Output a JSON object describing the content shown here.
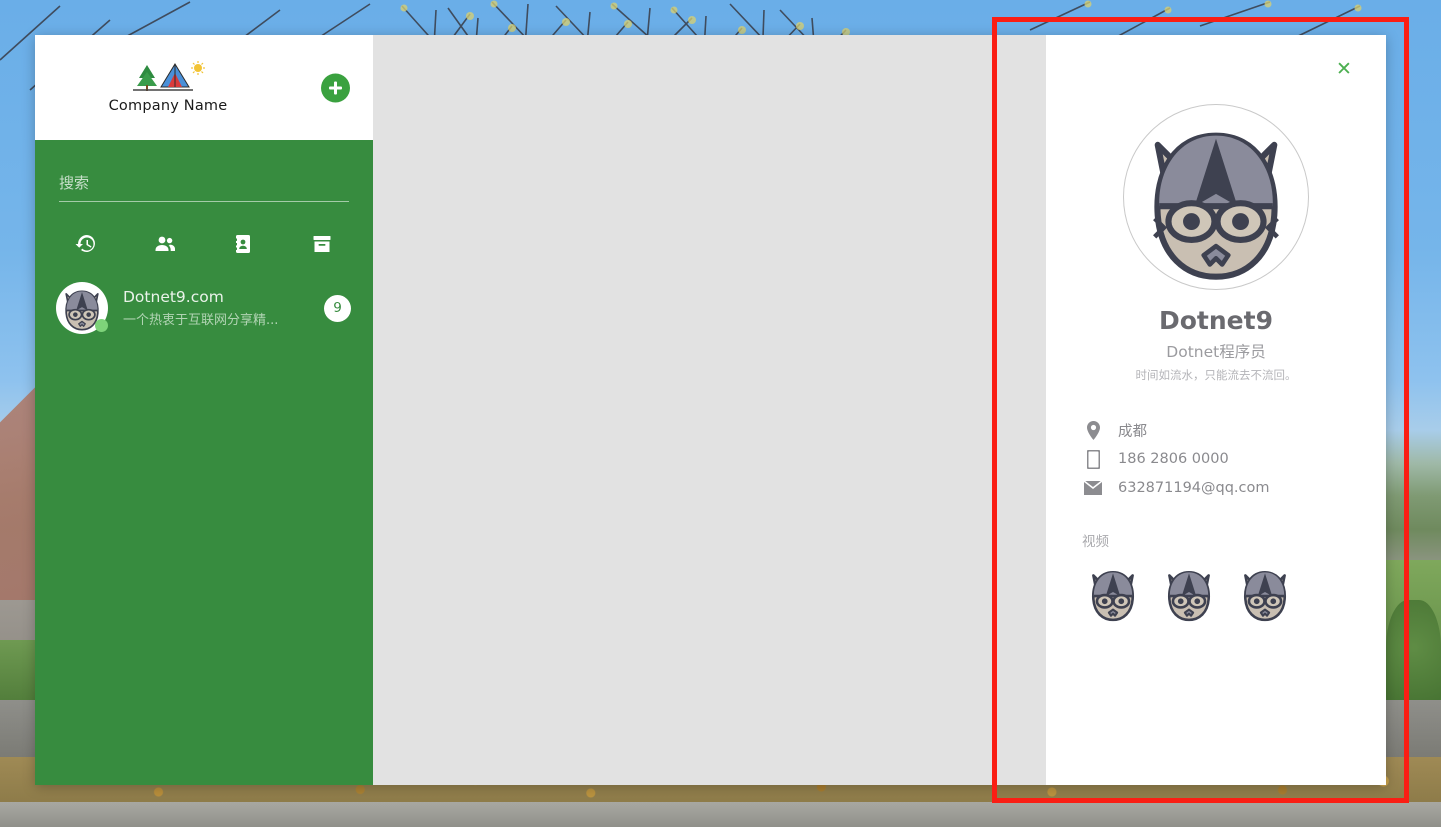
{
  "window": {
    "brand": {
      "name": "Company Name",
      "logo_icon": "campsite-logo-icon",
      "add_button_icon": "plus-icon",
      "add_button_label": "+"
    },
    "search": {
      "placeholder": "搜索",
      "value": ""
    },
    "tabs": [
      {
        "name": "recent",
        "icon": "history-restore-icon"
      },
      {
        "name": "contacts",
        "icon": "people-group-icon"
      },
      {
        "name": "directory",
        "icon": "contact-card-icon"
      },
      {
        "name": "archive",
        "icon": "archive-box-icon"
      }
    ],
    "contacts": [
      {
        "name": "Dotnet9.com",
        "snippet": "一个热衷于互联网分享精...",
        "badge": "9",
        "avatar_icon": "wolf-avatar-icon",
        "status": "online"
      }
    ]
  },
  "profile_panel": {
    "close_label": "✕",
    "close_icon": "close-icon",
    "avatar_icon": "wolf-avatar-icon",
    "name": "Dotnet9",
    "role": "Dotnet程序员",
    "motto": "时间如流水，只能流去不流回。",
    "details": [
      {
        "icon": "location-pin-icon",
        "value": "成都"
      },
      {
        "icon": "mobile-phone-icon",
        "value": "186 2806 0000"
      },
      {
        "icon": "envelope-mail-icon",
        "value": "632871194@qq.com"
      }
    ],
    "video": {
      "title": "视频",
      "thumbnails": [
        {
          "icon": "wolf-thumbnail-icon"
        },
        {
          "icon": "wolf-thumbnail-icon"
        },
        {
          "icon": "wolf-thumbnail-icon"
        }
      ]
    }
  },
  "annotation": {
    "color": "#fa1e14"
  }
}
